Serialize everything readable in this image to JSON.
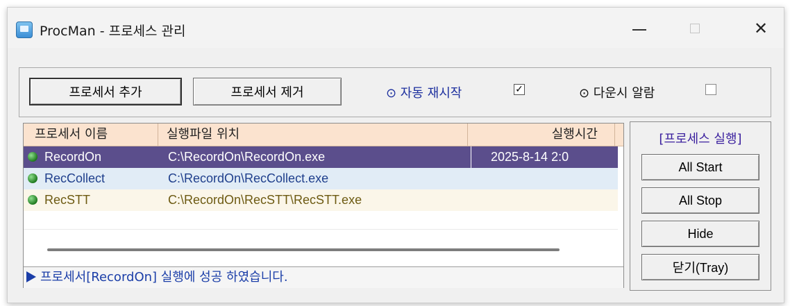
{
  "window": {
    "title": "ProcMan - 프로세스 관리",
    "minimize_icon": "minimize-icon",
    "maximize_icon": "maximize-icon",
    "close_label": "✕"
  },
  "toolbar": {
    "add_label": "프로세서 추가",
    "remove_label": "프로세서 제거",
    "auto_restart_label": "⊙ 자동 재시작",
    "auto_restart_checked": true,
    "auto_restart_check": "✓",
    "alarm_label": "⊙ 다운시 알람",
    "alarm_checked": false
  },
  "process_list": {
    "columns": [
      "프로세서 이름",
      "실행파일 위치",
      "실행시간"
    ],
    "rows": [
      {
        "name": "RecordOn",
        "path": "C:\\RecordOn\\RecordOn.exe",
        "time": "2025-8-14 2:0",
        "selected": true,
        "status_icon": "green-dot-icon"
      },
      {
        "name": "RecCollect",
        "path": "C:\\RecordOn\\RecCollect.exe",
        "time": "",
        "selected": false,
        "status_icon": "green-dot-icon"
      },
      {
        "name": "RecSTT",
        "path": "C:\\RecordOn\\RecSTT\\RecSTT.exe",
        "time": "",
        "selected": false,
        "status_icon": "green-dot-icon"
      }
    ]
  },
  "status": {
    "message": "프로세서[RecordOn] 실행에 성공 하였습니다."
  },
  "side_panel": {
    "title": "[프로세스 실행]",
    "buttons": [
      "All Start",
      "All Stop",
      "Hide",
      "닫기(Tray)"
    ]
  },
  "colors": {
    "selected_row": "#5b4e8c",
    "header_bg": "#fbe3cf",
    "status_text": "#1b3ea8",
    "accent_purple": "#3a1f9e"
  }
}
